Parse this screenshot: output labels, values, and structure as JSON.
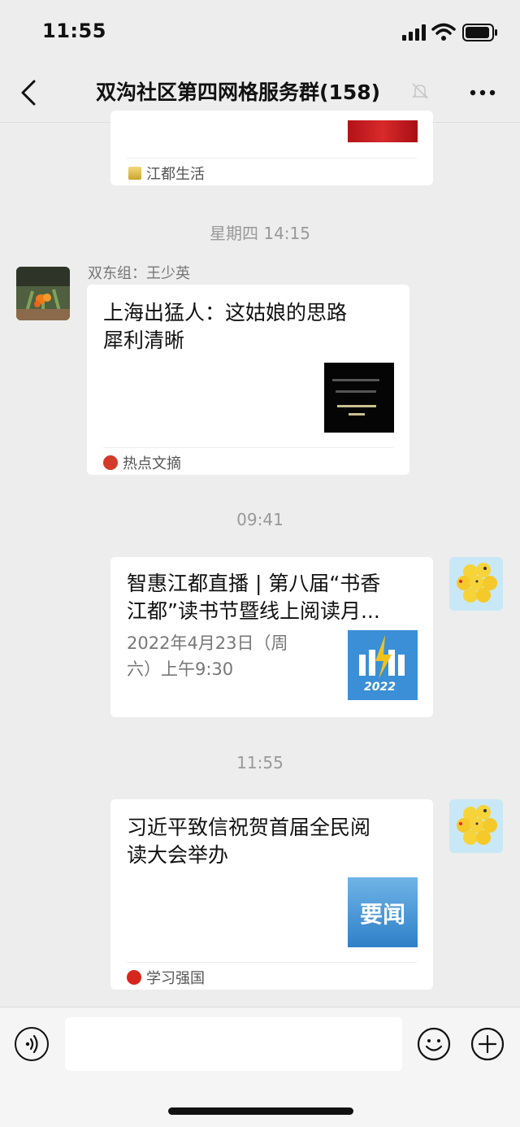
{
  "status_bar": {
    "time": "11:55"
  },
  "nav": {
    "title": "双沟社区第四网格服务群",
    "member_count": "(158)"
  },
  "messages": [
    {
      "source": "江都生活"
    },
    {
      "timestamp": "星期四 14:15"
    },
    {
      "sender": "双东组：王少英",
      "title_line1": "上海出猛人：这姑娘的思路",
      "title_line2": "犀利清晰",
      "source": "热点文摘"
    },
    {
      "timestamp": "09:41"
    },
    {
      "title_line1": "智惠江都直播 | 第八届“书香",
      "title_line2": "江都”读书节暨线上阅读月...",
      "desc_line1": "2022年4月23日（周",
      "desc_line2": "六）上午9:30",
      "thumb_year": "2022"
    },
    {
      "timestamp": "11:55"
    },
    {
      "title_line1": "习近平致信祝贺首届全民阅",
      "title_line2": "读大会举办",
      "thumb_text": "要闻",
      "source": "学习强国"
    }
  ],
  "colors": {
    "background": "#ededed",
    "card": "#ffffff",
    "red_thumb": "#c0141a",
    "blue_thumb": "#3a8fd6"
  },
  "icons": [
    "back-chevron-icon",
    "mute-bell-icon",
    "more-icon",
    "voice-icon",
    "emoji-icon",
    "plus-icon"
  ]
}
